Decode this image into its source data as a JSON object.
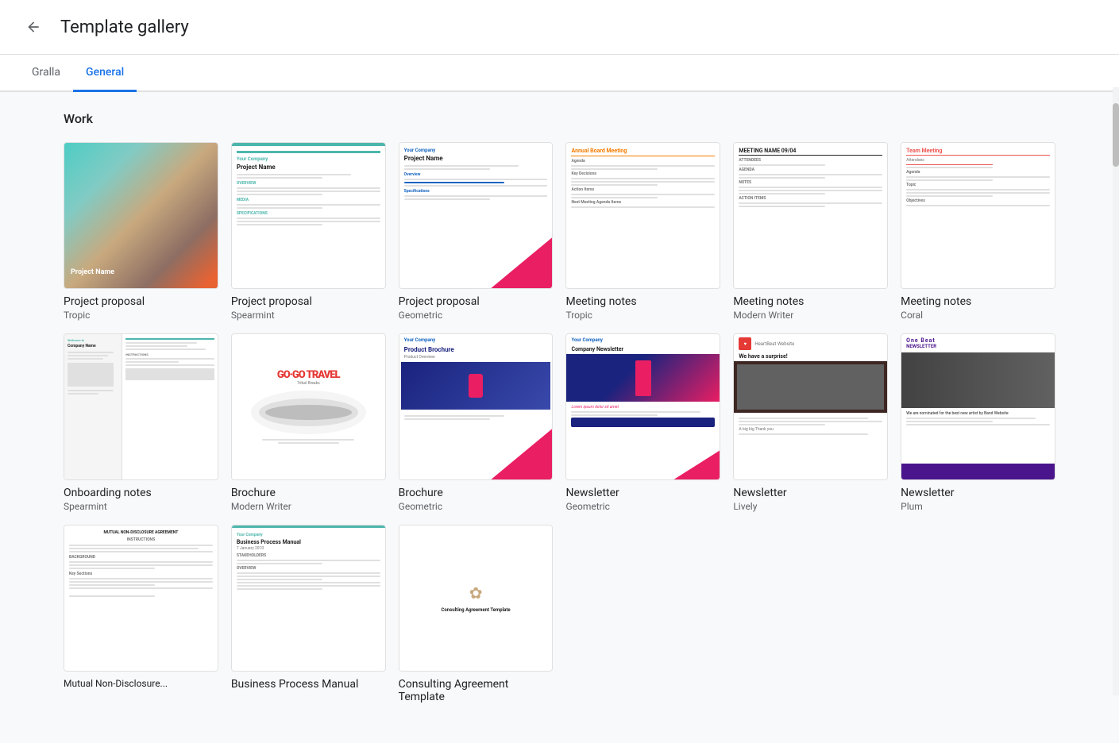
{
  "header": {
    "title": "Template gallery",
    "back_label": "Back"
  },
  "tabs": [
    {
      "id": "gralla",
      "label": "Gralla",
      "active": false
    },
    {
      "id": "general",
      "label": "General",
      "active": true
    }
  ],
  "sections": [
    {
      "id": "work",
      "title": "Work",
      "templates": [
        {
          "id": "project-proposal-tropic",
          "name": "Project proposal",
          "sub": "Tropic",
          "style": "tropic"
        },
        {
          "id": "project-proposal-spearmint",
          "name": "Project proposal",
          "sub": "Spearmint",
          "style": "spearmint"
        },
        {
          "id": "project-proposal-geometric",
          "name": "Project proposal",
          "sub": "Geometric",
          "style": "geometric"
        },
        {
          "id": "meeting-notes-tropic",
          "name": "Meeting notes",
          "sub": "Tropic",
          "style": "meeting-tropic"
        },
        {
          "id": "meeting-notes-modern",
          "name": "Meeting notes",
          "sub": "Modern Writer",
          "style": "meeting-modern"
        },
        {
          "id": "meeting-notes-coral",
          "name": "Meeting notes",
          "sub": "Coral",
          "style": "meeting-coral"
        },
        {
          "id": "onboarding-spearmint",
          "name": "Onboarding notes",
          "sub": "Spearmint",
          "style": "onboarding"
        },
        {
          "id": "brochure-modern-writer",
          "name": "Brochure",
          "sub": "Modern Writer",
          "style": "brochure-mw"
        },
        {
          "id": "brochure-geometric",
          "name": "Brochure",
          "sub": "Geometric",
          "style": "brochure-geo"
        },
        {
          "id": "newsletter-geometric",
          "name": "Newsletter",
          "sub": "Geometric",
          "style": "newsletter-geo"
        },
        {
          "id": "newsletter-lively",
          "name": "Newsletter",
          "sub": "Lively",
          "style": "newsletter-lively"
        },
        {
          "id": "newsletter-plum",
          "name": "Newsletter",
          "sub": "Plum",
          "style": "newsletter-plum"
        },
        {
          "id": "nda",
          "name": "Mutual Non-Disclosure Agreement",
          "sub": "",
          "style": "nda"
        },
        {
          "id": "bpm",
          "name": "Business Process Manual",
          "sub": "",
          "style": "bpm"
        },
        {
          "id": "consulting",
          "name": "Consulting Agreement Template",
          "sub": "",
          "style": "consulting"
        }
      ]
    }
  ]
}
